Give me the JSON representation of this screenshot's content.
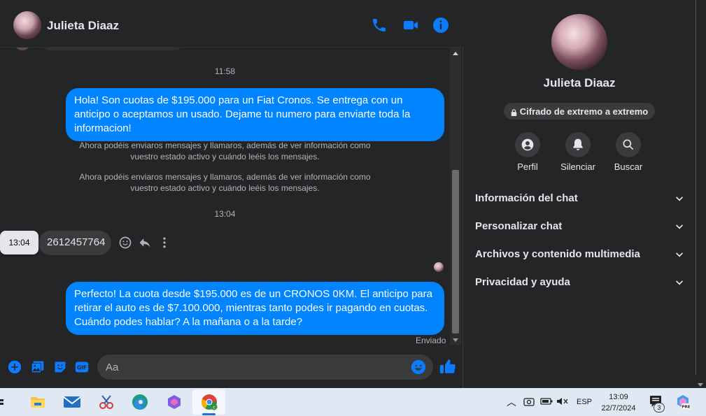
{
  "contact": {
    "name": "Julieta Diaaz"
  },
  "header": {
    "call_icon": "phone-icon",
    "video_icon": "video-icon",
    "info_icon": "info-icon"
  },
  "messages": {
    "ts1": "11:58",
    "out1": "Hola! Son cuotas de $195.000 para un Fiat Cronos. Se entrega con un anticipo o aceptamos un usado. Dejame tu numero para enviarte toda la informacion!",
    "sys1_line1": "Ahora podéis enviaros mensajes y llamaros, además de ver información como",
    "sys1_line2": "vuestro estado activo y cuándo leéis los mensajes.",
    "sys2_line1": "Ahora podéis enviaros mensajes y llamaros, además de ver información como",
    "sys2_line2": "vuestro estado activo y cuándo leéis los mensajes.",
    "ts2": "13:04",
    "hover_time": "13:04",
    "in1": "2612457764",
    "out2_line1": "Perfecto! La cuota desde $195.000 es de un CRONOS 0KM. El anticipo para",
    "out2_line2": "retirar el auto es de $7.100.000, mientras tanto podes ir pagando en cuotas.",
    "out2_line3": "Cuándo podes hablar? A la mañana o a la tarde?",
    "status": "Enviado"
  },
  "composer": {
    "placeholder": "Aa"
  },
  "info": {
    "name": "Julieta Diaaz",
    "e2e": "Cifrado de extremo a extremo",
    "actions": [
      {
        "label": "Perfil",
        "icon": "profile-icon"
      },
      {
        "label": "Silenciar",
        "icon": "bell-icon"
      },
      {
        "label": "Buscar",
        "icon": "search-icon"
      }
    ],
    "sections": [
      "Información del chat",
      "Personalizar chat",
      "Archivos y contenido multimedia",
      "Privacidad y ayuda"
    ]
  },
  "taskbar": {
    "lang": "ESP",
    "time": "13:09",
    "date": "22/7/2024",
    "notif_count": "3"
  },
  "colors": {
    "accent": "#0a7cff",
    "bubble_out": "#0084ff",
    "bg": "#242526",
    "bubble_in": "#3a3b3c"
  }
}
